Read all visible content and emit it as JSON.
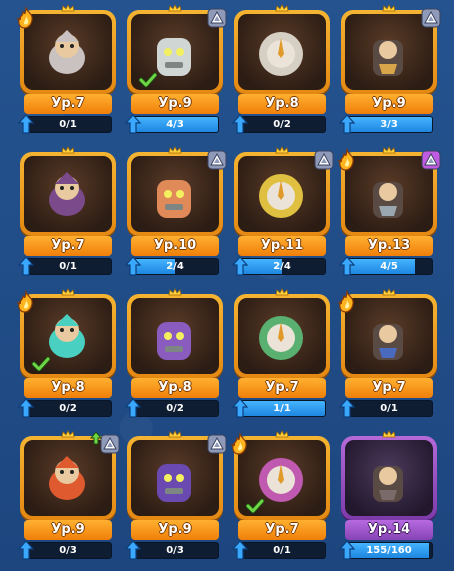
{
  "cards": [
    {
      "level": "Ур.7",
      "progress": "0/1",
      "progress_fraction": 0,
      "tag": "fire",
      "check": false,
      "hero": "dwarf-warrior-icon",
      "color": "#c9c2c0",
      "frame": "orange"
    },
    {
      "level": "Ур.9",
      "progress": "4/3",
      "progress_fraction": 1,
      "tag": "rank",
      "check": true,
      "hero": "stone-golem-icon",
      "color": "#cfd6d4",
      "frame": "orange"
    },
    {
      "level": "Ур.8",
      "progress": "0/2",
      "progress_fraction": 0,
      "tag": "none",
      "check": false,
      "hero": "sundial-icon",
      "color": "#d6cfc4",
      "frame": "orange"
    },
    {
      "level": "Ур.9",
      "progress": "3/3",
      "progress_fraction": 1,
      "tag": "rank",
      "check": false,
      "hero": "dwarf-smith-icon",
      "color": "#d9a54b",
      "frame": "orange"
    },
    {
      "level": "Ур.7",
      "progress": "0/1",
      "progress_fraction": 0,
      "tag": "none",
      "check": false,
      "hero": "spider-icon",
      "color": "#7a4a8a",
      "frame": "orange"
    },
    {
      "level": "Ур.10",
      "progress": "2/4",
      "progress_fraction": 0.5,
      "tag": "rank",
      "check": false,
      "hero": "monk-icon",
      "color": "#e08a5a",
      "frame": "orange"
    },
    {
      "level": "Ур.11",
      "progress": "2/4",
      "progress_fraction": 0.5,
      "tag": "rank",
      "check": false,
      "hero": "sword-bird-icon",
      "color": "#e0c040",
      "frame": "orange"
    },
    {
      "level": "Ур.13",
      "progress": "4/5",
      "progress_fraction": 0.8,
      "tag": "both",
      "check": false,
      "hero": "robot-icon",
      "color": "#9aa6b0",
      "frame": "orange"
    },
    {
      "level": "Ур.8",
      "progress": "0/2",
      "progress_fraction": 0,
      "tag": "fire",
      "check": true,
      "hero": "water-spirit-icon",
      "color": "#4ad0c0",
      "frame": "orange"
    },
    {
      "level": "Ур.8",
      "progress": "0/2",
      "progress_fraction": 0,
      "tag": "none",
      "check": false,
      "hero": "hourglass-mage-icon",
      "color": "#8a5cc0",
      "frame": "orange"
    },
    {
      "level": "Ур.7",
      "progress": "1/1",
      "progress_fraction": 1,
      "tag": "none",
      "check": false,
      "hero": "forest-deer-icon",
      "color": "#5ab070",
      "frame": "orange"
    },
    {
      "level": "Ур.7",
      "progress": "0/1",
      "progress_fraction": 0,
      "tag": "fire",
      "check": false,
      "hero": "witch-icon",
      "color": "#4a6ac0",
      "frame": "orange"
    },
    {
      "level": "Ур.9",
      "progress": "0/3",
      "progress_fraction": 0,
      "tag": "rankup",
      "check": false,
      "hero": "fire-dwarf-icon",
      "color": "#e05a30",
      "frame": "orange"
    },
    {
      "level": "Ур.9",
      "progress": "0/3",
      "progress_fraction": 0,
      "tag": "rank",
      "check": false,
      "hero": "wizard-icon",
      "color": "#6a4ab0",
      "frame": "orange"
    },
    {
      "level": "Ур.7",
      "progress": "0/1",
      "progress_fraction": 0,
      "tag": "fire",
      "check": true,
      "hero": "imp-icon",
      "color": "#c05ab0",
      "frame": "orange"
    },
    {
      "level": "Ур.14",
      "progress": "155/160",
      "progress_fraction": 0.97,
      "tag": "none",
      "check": false,
      "hero": "cannon-knight-icon",
      "color": "#7a6a6a",
      "frame": "purple"
    }
  ],
  "colors": {
    "background": "#1f4a84",
    "frame_orange": "#f5b432",
    "frame_purple": "#b56ad8",
    "progress_blue": "#2a9af0",
    "check_green": "#6fd646"
  }
}
